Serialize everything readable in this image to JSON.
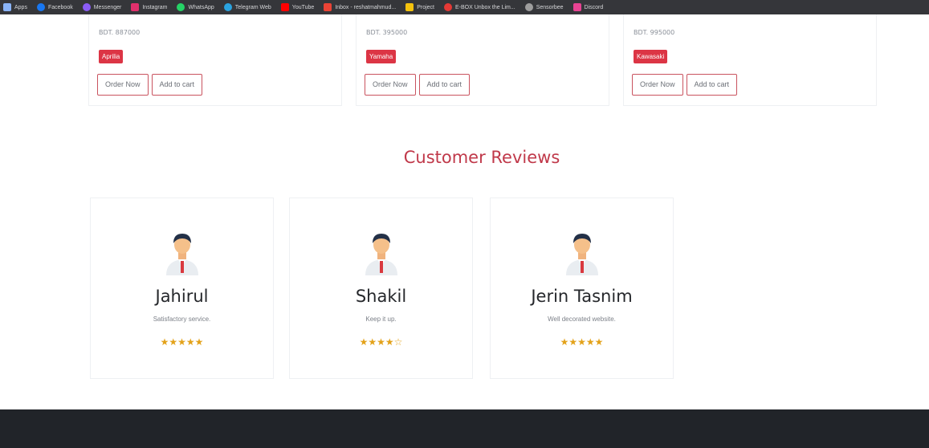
{
  "bookmarks": [
    {
      "label": "Apps",
      "color": "#8ab4f8"
    },
    {
      "label": "Facebook",
      "color": "#1877f2"
    },
    {
      "label": "Messenger",
      "color": "#8b5cf6"
    },
    {
      "label": "Instagram",
      "color": "#e1306c"
    },
    {
      "label": "WhatsApp",
      "color": "#25d366"
    },
    {
      "label": "Telegram Web",
      "color": "#2aa3e0"
    },
    {
      "label": "YouTube",
      "color": "#ff0000"
    },
    {
      "label": "Inbox - reshatmahmud...",
      "color": "#ea4335"
    },
    {
      "label": "Project",
      "color": "#f4c20d"
    },
    {
      "label": "E-BOX Unbox the Lim...",
      "color": "#e53935"
    },
    {
      "label": "Sensorbee",
      "color": "#9e9e9e"
    },
    {
      "label": "Discord",
      "color": "#e84393"
    }
  ],
  "products": [
    {
      "price": "BDT. 887000",
      "brand": "Aprilia"
    },
    {
      "price": "BDT. 395000",
      "brand": "Yamaha"
    },
    {
      "price": "BDT. 995000",
      "brand": "Kawasaki"
    }
  ],
  "buttons": {
    "order": "Order Now",
    "cart": "Add to cart"
  },
  "section_title": "Customer Reviews",
  "reviews": [
    {
      "name": "Jahirul",
      "text": "Satisfactory service.",
      "stars": "★★★★★",
      "rating": 5
    },
    {
      "name": "Shakil",
      "text": "Keep it up.",
      "stars": "★★★★☆",
      "rating": 4
    },
    {
      "name": "Jerin Tasnim",
      "text": "Well decorated website.",
      "stars": "★★★★★",
      "rating": 5
    }
  ],
  "colors": {
    "accent": "#dc3545",
    "title": "#c0394a",
    "star": "#e3a21a",
    "footer": "#212429"
  }
}
